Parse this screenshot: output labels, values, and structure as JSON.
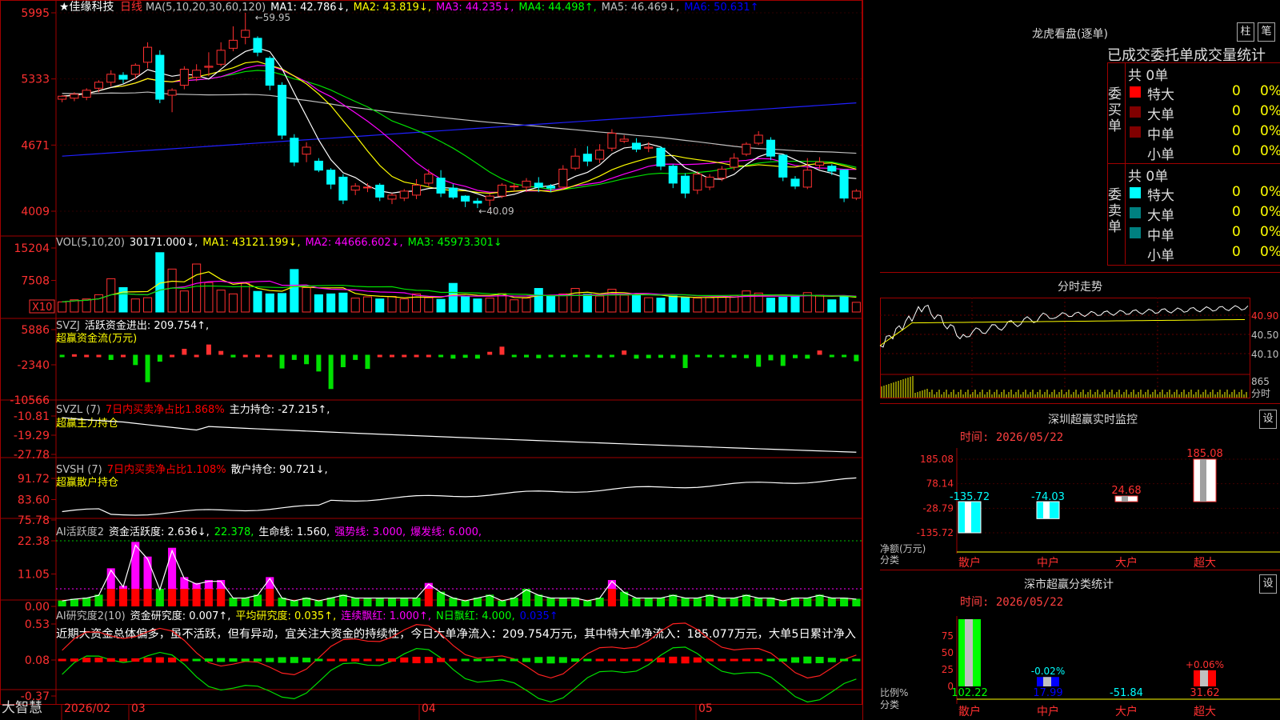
{
  "app": {
    "brand": "大智慧",
    "stock_title": "★佳缘科技",
    "period": "日线",
    "time_labels": [
      "2026/02",
      "03",
      "04",
      "05"
    ]
  },
  "colors": {
    "up": "#ff3030",
    "down": "#00ffff",
    "green": "#00e000",
    "magenta": "#ff00ff",
    "yellow": "#ffff00",
    "grid": "#a00000"
  },
  "panels": {
    "price": {
      "legend": [
        {
          "text": "MA(5,10,20,30,60,120)",
          "color": "#c0c0c0"
        },
        {
          "text": "MA1: 42.786↓,",
          "color": "#ffffff"
        },
        {
          "text": "MA2: 43.819↓,",
          "color": "#ffff00"
        },
        {
          "text": "MA3: 44.235↓,",
          "color": "#ff00ff"
        },
        {
          "text": "MA4: 44.498↑,",
          "color": "#00ff00"
        },
        {
          "text": "MA5: 46.469↓,",
          "color": "#c0c0c0"
        },
        {
          "text": "MA6: 50.631↑",
          "color": "#0000ff"
        }
      ],
      "y_ticks": [
        "5995",
        "5333",
        "4671",
        "4009"
      ],
      "high_label": "59.95",
      "low_label": "40.09"
    },
    "vol": {
      "legend": [
        {
          "text": "VOL(5,10,20)",
          "color": "#c0c0c0"
        },
        {
          "text": "30171.000↓,",
          "color": "#ffffff"
        },
        {
          "text": "MA1: 43121.199↓,",
          "color": "#ffff00"
        },
        {
          "text": "MA2: 44666.602↓,",
          "color": "#ff00ff"
        },
        {
          "text": "MA3: 45973.301↓",
          "color": "#00ff00"
        }
      ],
      "y_ticks": [
        "15204",
        "7508"
      ],
      "unit": "X10"
    },
    "svzj": {
      "legend": [
        {
          "text": "SVZJ",
          "color": "#c0c0c0"
        },
        {
          "text": "活跃资金进出: 209.754↑,",
          "color": "#ffffff"
        }
      ],
      "subtitle": "超赢资金流(万元)",
      "y_ticks": [
        "5886",
        "-2340",
        "-10566"
      ]
    },
    "svzl": {
      "legend": [
        {
          "text": "SVZL (7)",
          "color": "#c0c0c0"
        },
        {
          "text": "7日内买卖净占比1.868%",
          "color": "#ff0000"
        },
        {
          "text": "主力持仓: -27.215↑,",
          "color": "#ffffff"
        }
      ],
      "subtitle": "超赢主力持仓",
      "y_ticks": [
        "-10.81",
        "-19.29",
        "-27.78"
      ]
    },
    "svsh": {
      "legend": [
        {
          "text": "SVSH (7)",
          "color": "#c0c0c0"
        },
        {
          "text": "7日内买卖净占比1.108%",
          "color": "#ff0000"
        },
        {
          "text": "散户持仓: 90.721↓,",
          "color": "#ffffff"
        }
      ],
      "subtitle": "超赢散户持仓",
      "y_ticks": [
        "91.72",
        "83.60",
        "75.78"
      ]
    },
    "ai2": {
      "legend": [
        {
          "text": "AI活跃度2",
          "color": "#c0c0c0"
        },
        {
          "text": "资金活跃度: 2.636↓,",
          "color": "#ffffff"
        },
        {
          "text": "22.378,",
          "color": "#00ff00"
        },
        {
          "text": "生命线: 1.560,",
          "color": "#ffffff"
        },
        {
          "text": "强势线: 3.000,",
          "color": "#ff00ff"
        },
        {
          "text": "爆发线: 6.000,",
          "color": "#ff00ff"
        }
      ],
      "y_ticks": [
        "22.38",
        "11.05",
        "0.00"
      ]
    },
    "ai_research": {
      "legend": [
        {
          "text": "AI研究度2(10)",
          "color": "#c0c0c0"
        },
        {
          "text": "资金研究度: 0.007↑,",
          "color": "#ffffff"
        },
        {
          "text": "平均研究度: 0.035↑,",
          "color": "#ffff00"
        },
        {
          "text": "连续飘红: 1.000↑,",
          "color": "#ff00ff"
        },
        {
          "text": "N日飘红: 4.000,",
          "color": "#00ff00"
        },
        {
          "text": "0.035↑",
          "color": "#0000ff"
        }
      ],
      "comment": "近期大资金总体偏多，虽不活跃，但有异动，宜关注大资金的持续性，今日大单净流入：209.754万元，其中特大单净流入：185.077万元，大单5日累计净入",
      "y_ticks": [
        "0.53",
        "0.08",
        "-0.37"
      ]
    }
  },
  "side": {
    "dragon": {
      "title": "龙虎看盘(逐单)",
      "btn1": "柱",
      "btn2": "笔",
      "stats_title": "已成交委托单成交量统计",
      "buy": {
        "label": "委买单",
        "total": "共 0单",
        "rows": [
          {
            "name": "特大",
            "count": "0",
            "pct": "0%",
            "color": "#ff0000"
          },
          {
            "name": "大单",
            "count": "0",
            "pct": "0%",
            "color": "#800000"
          },
          {
            "name": "中单",
            "count": "0",
            "pct": "0%",
            "color": "#800000"
          },
          {
            "name": "小单",
            "count": "0",
            "pct": "0%",
            "color": ""
          }
        ]
      },
      "sell": {
        "label": "委卖单",
        "total": "共 0单",
        "rows": [
          {
            "name": "特大",
            "count": "0",
            "pct": "0%",
            "color": "#00ffff"
          },
          {
            "name": "大单",
            "count": "0",
            "pct": "0%",
            "color": "#008080"
          },
          {
            "name": "中单",
            "count": "0",
            "pct": "0%",
            "color": "#008080"
          },
          {
            "name": "小单",
            "count": "0",
            "pct": "0%",
            "color": ""
          }
        ]
      }
    },
    "intraday": {
      "title": "分时走势",
      "y_ticks": [
        "40.90",
        "40.50",
        "40.10"
      ],
      "vol_tick": "865",
      "vol_label": "分时"
    },
    "monitor": {
      "title": "深圳超赢实时监控",
      "btn": "设",
      "time": "时间: 2026/05/22",
      "y_ticks": [
        "185.08",
        "78.14",
        "-28.79",
        "-135.72"
      ],
      "ylabel": "净额(万元)",
      "xlabel": "分类",
      "categories": [
        "散户",
        "中户",
        "大户",
        "超大"
      ],
      "values": [
        -135.72,
        -74.03,
        24.68,
        185.08
      ],
      "value_labels": [
        "-135.72",
        "-74.03",
        "24.68",
        "185.08"
      ]
    },
    "classify": {
      "title": "深市超赢分类统计",
      "btn": "设",
      "time": "时间: 2026/05/22",
      "y_ticks": [
        "75",
        "50",
        "25",
        "0"
      ],
      "ylabel": "比例%",
      "xlabel": "分类",
      "categories": [
        "散户",
        "中户",
        "大户",
        "超大"
      ],
      "pct_labels": [
        "",
        "-0.02%",
        "",
        "+0.06%"
      ],
      "bottom_values": [
        "102.22",
        "17.99",
        "-51.84",
        "31.62"
      ]
    }
  },
  "chart_data": {
    "type": "candlestick",
    "x": [
      "2026/02",
      "03",
      "04",
      "05"
    ],
    "price": {
      "ylim": [
        4009,
        5995
      ],
      "ohlc": [
        [
          5130,
          5160,
          5100,
          5170
        ],
        [
          5140,
          5180,
          5110,
          5200
        ],
        [
          5150,
          5220,
          5120,
          5240
        ],
        [
          5240,
          5300,
          5200,
          5320
        ],
        [
          5300,
          5380,
          5260,
          5420
        ],
        [
          5370,
          5330,
          5290,
          5400
        ],
        [
          5380,
          5470,
          5330,
          5490
        ],
        [
          5500,
          5650,
          5440,
          5700
        ],
        [
          5570,
          5130,
          5090,
          5620
        ],
        [
          5170,
          5220,
          5000,
          5240
        ],
        [
          5270,
          5430,
          5230,
          5460
        ],
        [
          5350,
          5420,
          5310,
          5480
        ],
        [
          5450,
          5460,
          5360,
          5600
        ],
        [
          5480,
          5620,
          5460,
          5700
        ],
        [
          5640,
          5720,
          5610,
          5860
        ],
        [
          5750,
          5820,
          5680,
          5995
        ],
        [
          5740,
          5600,
          5560,
          5760
        ],
        [
          5540,
          5270,
          5220,
          5560
        ],
        [
          5270,
          4770,
          4730,
          5300
        ],
        [
          4740,
          4500,
          4460,
          4780
        ],
        [
          4580,
          4650,
          4500,
          4700
        ],
        [
          4510,
          4420,
          4400,
          4540
        ],
        [
          4420,
          4280,
          4230,
          4440
        ],
        [
          4350,
          4120,
          4080,
          4380
        ],
        [
          4220,
          4260,
          4170,
          4290
        ],
        [
          4250,
          4250,
          4200,
          4290
        ],
        [
          4270,
          4150,
          4110,
          4290
        ],
        [
          4130,
          4170,
          4080,
          4190
        ],
        [
          4140,
          4210,
          4110,
          4230
        ],
        [
          4170,
          4270,
          4130,
          4330
        ],
        [
          4290,
          4380,
          4260,
          4430
        ],
        [
          4340,
          4190,
          4150,
          4420
        ],
        [
          4240,
          4150,
          4130,
          4280
        ],
        [
          4160,
          4110,
          4050,
          4170
        ],
        [
          4110,
          4090,
          4040,
          4140
        ],
        [
          4120,
          4160,
          4060,
          4180
        ],
        [
          4160,
          4270,
          4140,
          4290
        ],
        [
          4260,
          4260,
          4210,
          4290
        ],
        [
          4250,
          4310,
          4200,
          4340
        ],
        [
          4290,
          4250,
          4200,
          4350
        ],
        [
          4260,
          4240,
          4200,
          4280
        ],
        [
          4250,
          4430,
          4230,
          4470
        ],
        [
          4440,
          4560,
          4420,
          4640
        ],
        [
          4580,
          4510,
          4460,
          4660
        ],
        [
          4530,
          4620,
          4490,
          4680
        ],
        [
          4640,
          4790,
          4610,
          4830
        ],
        [
          4710,
          4730,
          4690,
          4770
        ],
        [
          4690,
          4630,
          4600,
          4740
        ],
        [
          4640,
          4650,
          4600,
          4700
        ],
        [
          4640,
          4460,
          4420,
          4660
        ],
        [
          4460,
          4290,
          4240,
          4480
        ],
        [
          4360,
          4190,
          4140,
          4390
        ],
        [
          4220,
          4380,
          4180,
          4410
        ],
        [
          4250,
          4350,
          4220,
          4380
        ],
        [
          4340,
          4430,
          4310,
          4460
        ],
        [
          4450,
          4540,
          4420,
          4590
        ],
        [
          4580,
          4680,
          4560,
          4700
        ],
        [
          4690,
          4770,
          4670,
          4810
        ],
        [
          4720,
          4560,
          4520,
          4750
        ],
        [
          4570,
          4350,
          4310,
          4580
        ],
        [
          4330,
          4260,
          4230,
          4360
        ],
        [
          4250,
          4420,
          4230,
          4540
        ],
        [
          4470,
          4500,
          4430,
          4550
        ],
        [
          4460,
          4410,
          4370,
          4480
        ],
        [
          4420,
          4140,
          4100,
          4430
        ],
        [
          4140,
          4210,
          4120,
          4230
        ]
      ]
    },
    "volume": {
      "ylim": [
        0,
        15204
      ],
      "values": [
        2400,
        2900,
        3100,
        4100,
        7900,
        5800,
        3100,
        3400,
        14100,
        10200,
        5000,
        11400,
        7000,
        5200,
        4300,
        6800,
        4900,
        4300,
        4400,
        10100,
        5800,
        4100,
        4300,
        4500,
        3300,
        3600,
        3100,
        3700,
        3100,
        4300,
        3400,
        3000,
        6800,
        3600,
        3100,
        3300,
        4400,
        2900,
        3300,
        5600,
        3800,
        4300,
        5600,
        4200,
        3800,
        5400,
        4000,
        3900,
        3400,
        3300,
        3800,
        3500,
        3300,
        3400,
        3500,
        3900,
        5000,
        4500,
        3300,
        3500,
        3700,
        4600,
        4000,
        2900,
        3800,
        2300
      ]
    }
  }
}
